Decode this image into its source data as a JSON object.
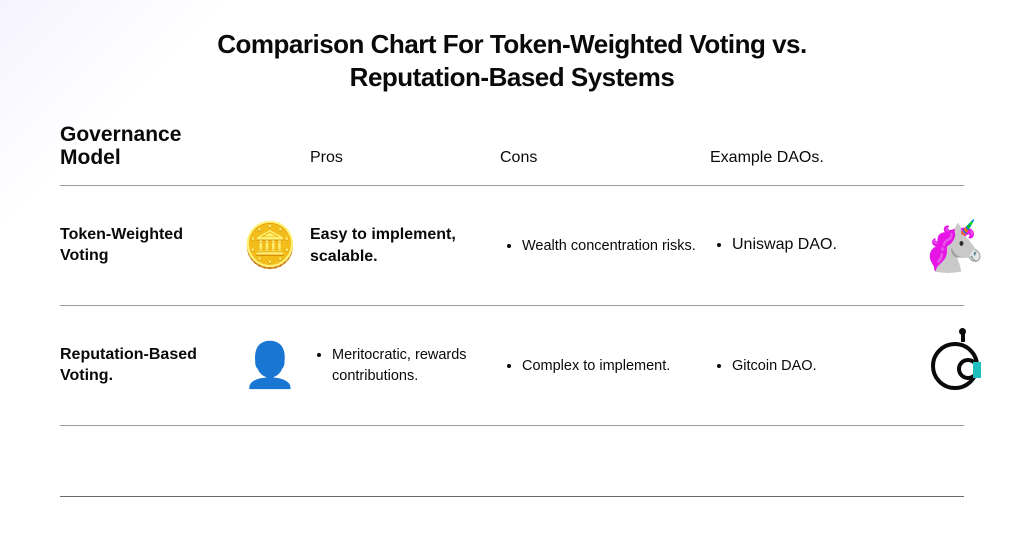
{
  "title": "Comparison Chart For Token-Weighted Voting vs. Reputation-Based Systems",
  "headers": {
    "governance": "Governance Model",
    "pros": "Pros",
    "cons": "Cons",
    "examples": "Example DAOs."
  },
  "rows": [
    {
      "name": "Token-Weighted Voting",
      "icon": "🪙",
      "pros_text": "Easy to implement, scalable.",
      "cons": [
        "Wealth concentration risks."
      ],
      "examples": [
        "Uniswap DAO."
      ],
      "logo": "unicorn"
    },
    {
      "name": "Reputation-Based Voting.",
      "icon": "👤",
      "pros_bullets": [
        "Meritocratic, rewards contributions."
      ],
      "cons": [
        "Complex to implement."
      ],
      "examples": [
        "Gitcoin DAO."
      ],
      "logo": "gitcoin"
    }
  ]
}
